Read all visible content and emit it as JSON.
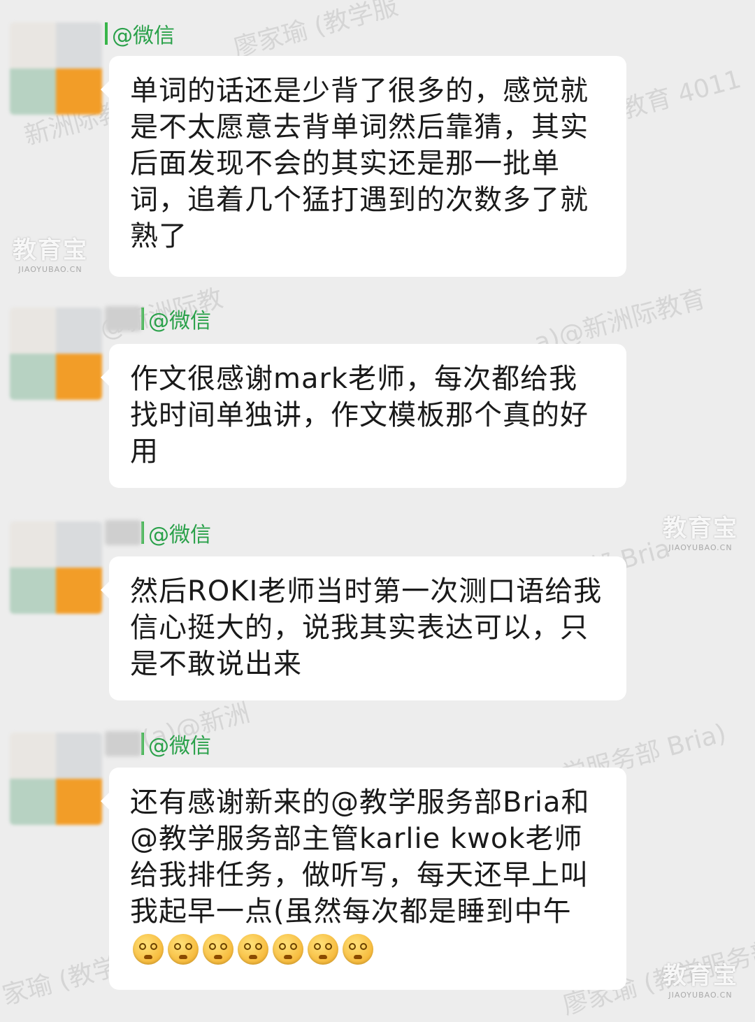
{
  "sender_label": "@微信",
  "messages": [
    {
      "text": "单词的话还是少背了很多的，感觉就是不太愿意去背单词然后靠猜，其实后面发现不会的其实还是那一批单词，追着几个猛打遇到的次数多了就熟了"
    },
    {
      "text": "作文很感谢mark老师，每次都给我找时间单独讲，作文模板那个真的好用"
    },
    {
      "text": "然后ROKI老师当时第一次测口语给我信心挺大的，说我其实表达可以，只是不敢说出来"
    },
    {
      "text": "还有感谢新来的@教学服务部Bria和@教学服务部主管karlie kwok老师给我排任务，做听写，每天还早上叫我起早一点(虽然每次都是睡到中午",
      "emoji_count": 7,
      "emoji_icon": "dizzy-face-emoji"
    }
  ],
  "watermarks": [
    "廖家瑜 (教学服",
    "新洲际教育 4011",
    "新洲际教育 4011",
    "a)@新洲际教育",
    "@新洲际教",
    "部 Bria",
    "(a)@新洲",
    "学服务部 Bria)",
    "家瑜 (教学服",
    "廖家瑜 (教学服务部"
  ],
  "logo": {
    "name": "教育宝",
    "domain": "JIAOYUBAO.CN"
  }
}
